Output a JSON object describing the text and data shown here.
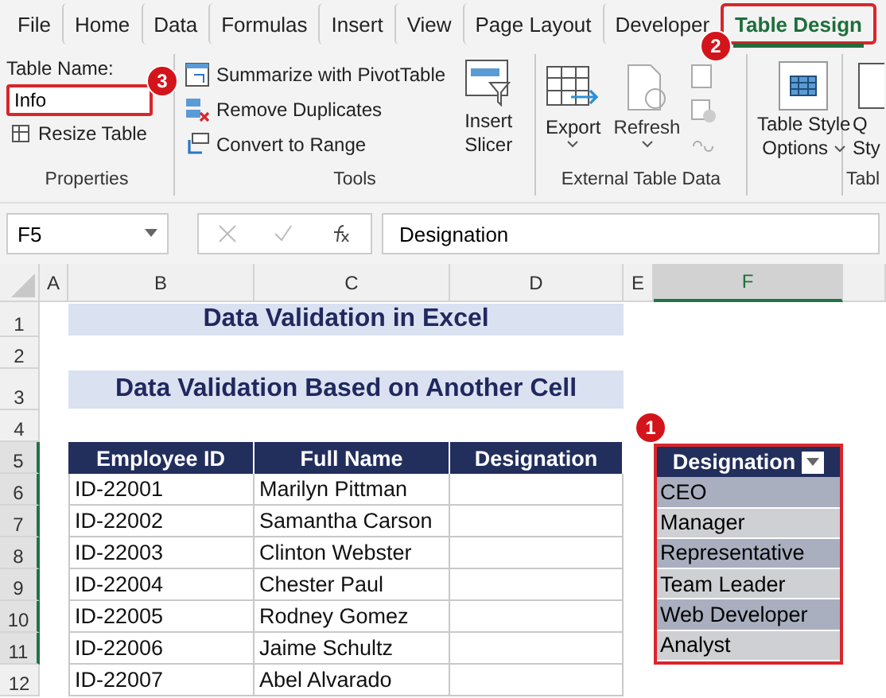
{
  "menu_tabs": [
    {
      "label": "File",
      "selected": false
    },
    {
      "label": "Home",
      "selected": false
    },
    {
      "label": "Data",
      "selected": false
    },
    {
      "label": "Formulas",
      "selected": false
    },
    {
      "label": "Insert",
      "selected": false
    },
    {
      "label": "View",
      "selected": false
    },
    {
      "label": "Page Layout",
      "selected": false
    },
    {
      "label": "Developer",
      "selected": false
    },
    {
      "label": "Table Design",
      "selected": true,
      "callout": "2"
    }
  ],
  "properties": {
    "name_label": "Table Name:",
    "name_value": "Info",
    "callout": "3",
    "resize": "Resize Table",
    "group": "Properties"
  },
  "tools": {
    "items": [
      {
        "kind": "pivot",
        "label": "Summarize with PivotTable"
      },
      {
        "kind": "dedupe",
        "label": "Remove Duplicates"
      },
      {
        "kind": "convert",
        "label": "Convert to Range"
      }
    ],
    "slicer": [
      "Insert",
      "Slicer"
    ],
    "group": "Tools"
  },
  "external": {
    "export": "Export",
    "refresh": "Refresh",
    "group": "External Table Data"
  },
  "style_options": [
    "Table Style",
    "Options"
  ],
  "quick_styles": {
    "lines": [
      "Q",
      "Sty"
    ],
    "group": "Tabl"
  },
  "formula_bar": {
    "name_box": "F5",
    "formula": "Designation"
  },
  "columns": [
    {
      "label": "A",
      "selected": false
    },
    {
      "label": "B",
      "selected": false
    },
    {
      "label": "C",
      "selected": false
    },
    {
      "label": "D",
      "selected": false
    },
    {
      "label": "E",
      "selected": false
    },
    {
      "label": "F",
      "selected": true
    }
  ],
  "rows": [
    {
      "label": "1",
      "selected": false
    },
    {
      "label": "2",
      "selected": false
    },
    {
      "label": "3",
      "selected": false
    },
    {
      "label": "4",
      "selected": false
    },
    {
      "label": "5",
      "selected": true
    },
    {
      "label": "6",
      "selected": true
    },
    {
      "label": "7",
      "selected": true
    },
    {
      "label": "8",
      "selected": true
    },
    {
      "label": "9",
      "selected": true
    },
    {
      "label": "10",
      "selected": true
    },
    {
      "label": "11",
      "selected": true
    },
    {
      "label": "12",
      "selected": false
    }
  ],
  "titles": [
    "Data Validation in Excel",
    "Data Validation Based on Another Cell"
  ],
  "employee_table": {
    "columns": [
      "Employee ID",
      "Full Name",
      "Designation"
    ],
    "rows": [
      {
        "id": "ID-22001",
        "name": "Marilyn Pittman"
      },
      {
        "id": "ID-22002",
        "name": "Samantha Carson"
      },
      {
        "id": "ID-22003",
        "name": "Clinton Webster"
      },
      {
        "id": "ID-22004",
        "name": "Chester Paul"
      },
      {
        "id": "ID-22005",
        "name": "Rodney Gomez"
      },
      {
        "id": "ID-22006",
        "name": "Jaime Schultz"
      },
      {
        "id": "ID-22007",
        "name": "Abel Alvarado"
      }
    ]
  },
  "designation_list": {
    "header": "Designation",
    "callout": "1",
    "items": [
      "CEO",
      "Manager",
      "Representative",
      "Team Leader",
      "Web Developer",
      "Analyst"
    ]
  }
}
